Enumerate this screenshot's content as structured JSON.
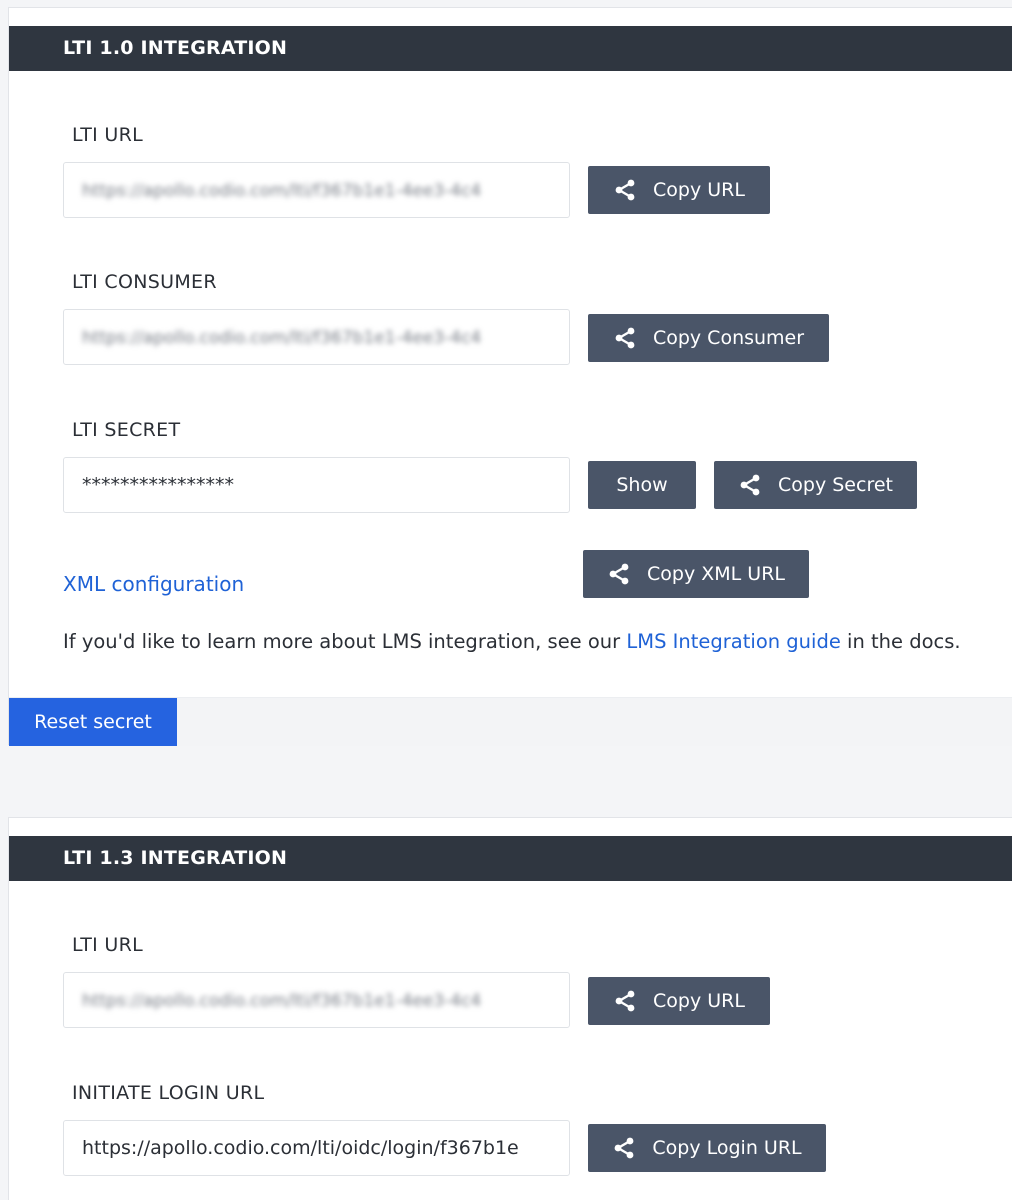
{
  "lti10": {
    "title": "LTI 1.0 INTEGRATION",
    "url_label": "LTI URL",
    "url_value": "https://apollo.codio.com/lti/f367b1e1-4ee3-4c4",
    "copy_url": "Copy URL",
    "consumer_label": "LTI CONSUMER",
    "consumer_value": "https://apollo.codio.com/lti/f367b1e1-4ee3-4c4",
    "copy_consumer": "Copy Consumer",
    "secret_label": "LTI SECRET",
    "secret_value": "****************",
    "show": "Show",
    "copy_secret": "Copy Secret",
    "xml_link": "XML configuration",
    "copy_xml": "Copy XML URL",
    "info_before": "If you'd like to learn more about LMS integration, see our ",
    "info_link": "LMS Integration guide",
    "info_after": " in the docs.",
    "reset": "Reset secret"
  },
  "lti13": {
    "title": "LTI 1.3 INTEGRATION",
    "url_label": "LTI URL",
    "url_value": "https://apollo.codio.com/lti/f367b1e1-4ee3-4c4",
    "copy_url": "Copy URL",
    "login_label": "INITIATE LOGIN URL",
    "login_value": "https://apollo.codio.com/lti/oidc/login/f367b1e",
    "copy_login": "Copy Login URL"
  },
  "icons": {
    "share": "share-icon"
  }
}
